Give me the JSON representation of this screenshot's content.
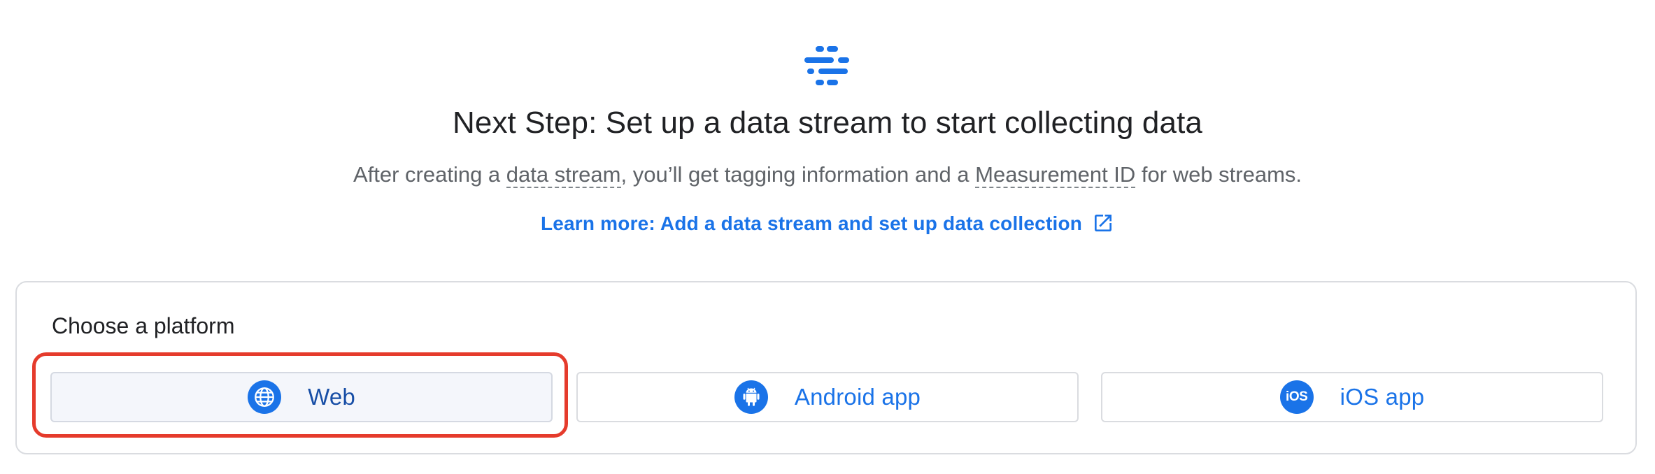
{
  "header": {
    "icon": "data-stream-icon",
    "title": "Next Step: Set up a data stream to start collecting data",
    "subtitle_before": "After creating a ",
    "subtitle_term1": "data stream",
    "subtitle_middle": ", you’ll get tagging information and a ",
    "subtitle_term2": "Measurement ID",
    "subtitle_after": " for web streams.",
    "learn_more_label": "Learn more: Add a data stream and set up data collection",
    "learn_more_icon": "open-in-new-icon"
  },
  "platform": {
    "title": "Choose a platform",
    "buttons": [
      {
        "label": "Web",
        "icon": "globe-icon",
        "selected": true
      },
      {
        "label": "Android app",
        "icon": "android-icon",
        "selected": false
      },
      {
        "label": "iOS app",
        "icon": "ios-icon",
        "icon_text": "iOS",
        "selected": false
      }
    ]
  },
  "colors": {
    "accent": "#1a73e8",
    "highlight": "#e53b2c",
    "selected_bg": "#f4f6fb",
    "border": "#dadce0"
  }
}
